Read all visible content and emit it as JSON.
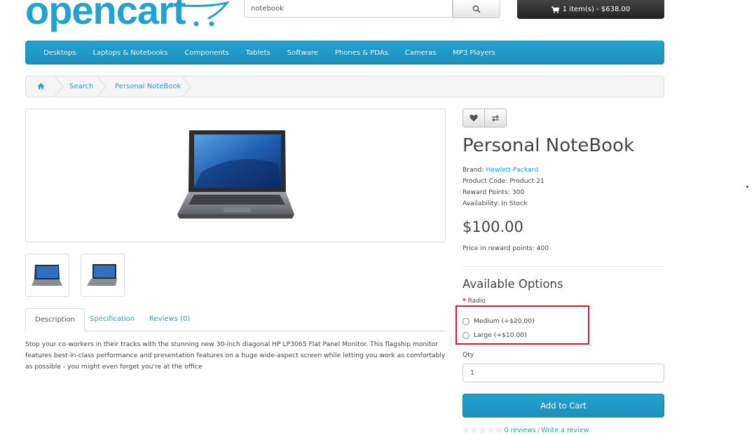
{
  "header": {
    "logo_text": "opencart",
    "search_value": "notebook",
    "cart_label": "1 item(s) - $638.00"
  },
  "menu": {
    "items": [
      "Desktops",
      "Laptops & Notebooks",
      "Components",
      "Tablets",
      "Software",
      "Phones & PDAs",
      "Cameras",
      "MP3 Players"
    ]
  },
  "breadcrumb": {
    "items": [
      "Search",
      "Personal NoteBook"
    ]
  },
  "tabs": {
    "items": [
      "Description",
      "Specification",
      "Reviews (0)"
    ],
    "active": "Description"
  },
  "description": "Stop your co-workers in their tracks with the stunning new 30-inch diagonal HP LP3065 Flat Panel Monitor. This flagship monitor features best-in-class performance and presentation features on a huge wide-aspect screen while letting you work as comfortably as possible - you might even forget you're at the office",
  "product": {
    "title": "Personal NoteBook",
    "brand_label": "Brand:",
    "brand_value": "Hewlett-Packard",
    "code": "Product Code: Product 21",
    "reward": "Reward Points: 300",
    "availability": "Availability: In Stock",
    "price": "$100.00",
    "price_points": "Price in reward points: 400"
  },
  "options": {
    "title": "Available Options",
    "required_mark": "*",
    "radio_label": "Radio",
    "radio_options": [
      "Medium (+$20.00)",
      "Large (+$10.00)"
    ]
  },
  "qty": {
    "label": "Qty",
    "value": "1"
  },
  "add_to_cart_label": "Add to Cart",
  "reviews": {
    "reviews_link": "0 reviews",
    "separator": "/",
    "write_link": "Write a review"
  },
  "colors": {
    "accent": "#23a1d1",
    "highlight": "#e3152b"
  }
}
